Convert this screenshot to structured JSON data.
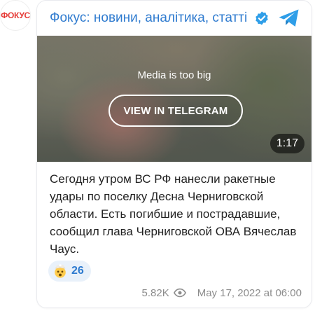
{
  "channel": {
    "avatar_text": "ФОКУС",
    "name": "Фокус: новини, аналітика, статті",
    "verified_icon": "verified-check-icon",
    "platform_icon": "telegram-logo-icon"
  },
  "media": {
    "message": "Media is too big",
    "button_label": "VIEW IN TELEGRAM",
    "duration": "1:17"
  },
  "post": {
    "text": "Сегодня утром ВС РФ нанесли ракетные удары по поселку Десна Черниговской области. Есть погибшие и пострадавшие, сообщил глава Черниговской ОВА Вячеслав Чаус."
  },
  "reaction": {
    "emoji": "exploding-head",
    "count": "26"
  },
  "meta": {
    "views": "5.82K",
    "date": "May 17, 2022 at 06:00"
  },
  "colors": {
    "link_blue": "#2f7bcf",
    "avatar_red": "#e53935",
    "reaction_bg": "#e9f1fa",
    "meta_gray": "#8c8c8c"
  }
}
